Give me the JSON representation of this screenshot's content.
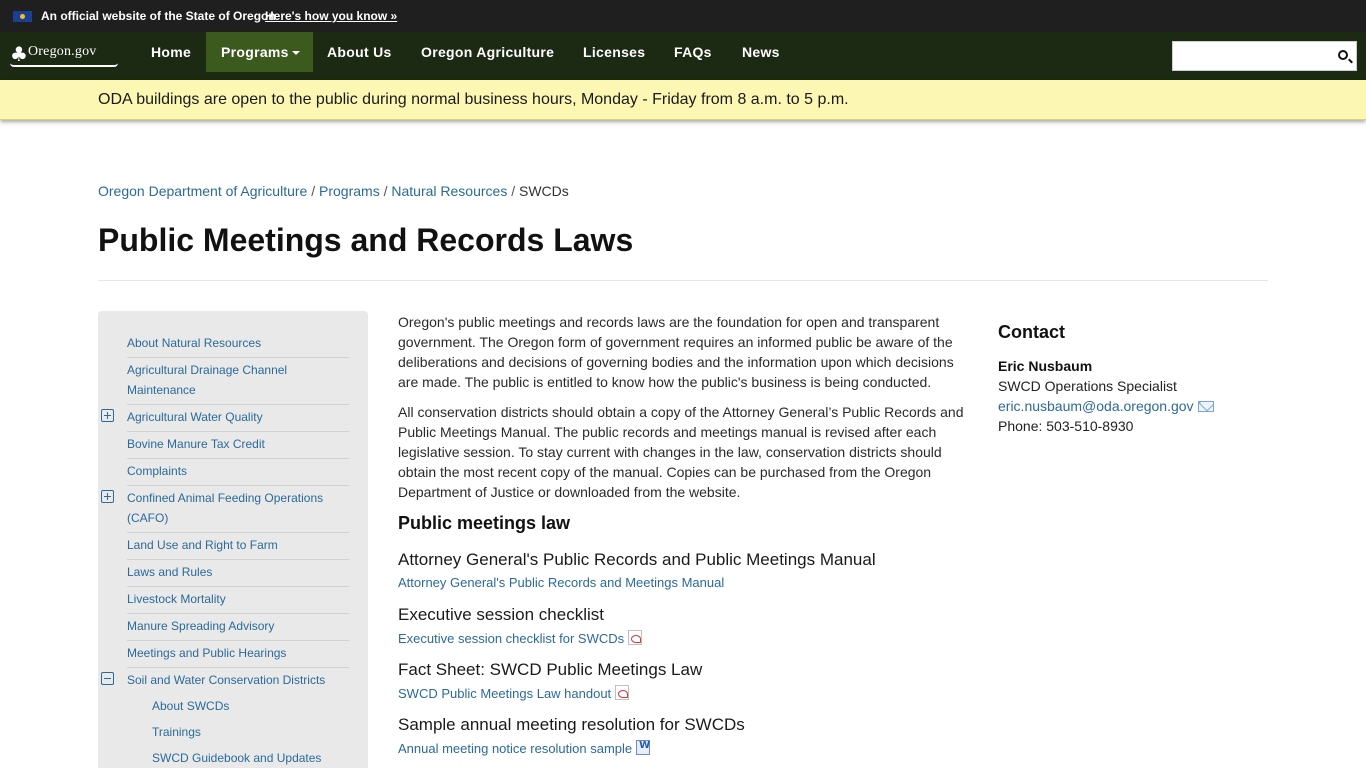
{
  "gov_banner": {
    "text": "An official website of the State of Oregon",
    "link": "Here's how you know »"
  },
  "navbar": {
    "logo_text": "Oregon.gov",
    "items": [
      {
        "label": "Home"
      },
      {
        "label": "Programs"
      },
      {
        "label": "About Us"
      },
      {
        "label": "Oregon Agriculture"
      },
      {
        "label": "Licenses"
      },
      {
        "label": "FAQs"
      },
      {
        "label": "News"
      }
    ],
    "search_placeholder": ""
  },
  "alert": {
    "text": "ODA buildings are open to the public during normal business hours, Monday - Friday from 8 a.m. to 5 p.m."
  },
  "breadcrumb": {
    "items": [
      "Oregon Department of Agriculture",
      "Programs",
      "Natural Resources"
    ],
    "current": "SWCDs",
    "separator": "/"
  },
  "page": {
    "title": "Public Meetings and Records Laws"
  },
  "sidebar": {
    "items": [
      {
        "label": "About Natural Resources"
      },
      {
        "label": "Agricultural Drainage Channel Maintenance"
      },
      {
        "label": "Agricultural Water Quality"
      },
      {
        "label": "Bovine Manure Tax Credit"
      },
      {
        "label": "Complaints"
      },
      {
        "label": "Confined Animal Feeding Operations (CAFO)"
      },
      {
        "label": "Land Use and Right to Farm"
      },
      {
        "label": "Laws and Rules"
      },
      {
        "label": "Livestock Mortality"
      },
      {
        "label": "Manure Spreading Advisory"
      },
      {
        "label": "Meetings and Public Hearings"
      },
      {
        "label": "Soil and Water Conservation Districts"
      }
    ],
    "subitems": [
      {
        "label": "About SWCDs"
      },
      {
        "label": "Trainings"
      },
      {
        "label": "SWCD Guidebook and Updates"
      }
    ]
  },
  "main": {
    "paragraphs": [
      "Oregon's public meetings and records laws are the foundation for open and transparent government. The Oregon form of government requires an informed public be aware of the deliberations and decisions of governing bodies and the information upon which decisions are made. The public is entitled to know how the public's business is being conducted.",
      "All conservation districts should obtain a copy of the Attorney General’s Public Records and Public Meetings Manual. The public records and meetings manual is revised after each legislative session. To stay current with changes in the law, conservation districts should obtain the most recent copy of the manual. Copies can be purchased from the Oregon Department of Justice or downloaded from the website."
    ],
    "section_heading": "Public meetings law",
    "documents": [
      {
        "title": "Attorney General's Public Records and Public Meetings Manual",
        "link": "Attorney General's Public Records and Meetings Manual",
        "icon": "none"
      },
      {
        "title": "Executive session checklist",
        "link": "Executive session checklist for SWCDs",
        "icon": "pdf-icon"
      },
      {
        "title": "Fact Sheet: SWCD Public Meetings Law",
        "link": "SWCD Public Meetings Law handout",
        "icon": "pdf-icon"
      },
      {
        "title": "Sample annual meeting resolution for SWCDs",
        "link": "Annual meeting notice resolution sample",
        "icon": "word-doc-icon"
      }
    ]
  },
  "contact": {
    "heading": "Contact",
    "name": "Eric Nusbaum",
    "role": "SWCD Operations Specialist",
    "email": "eric.nusbaum@oda.oregon.gov",
    "phone": "Phone: 503-510-8930"
  },
  "colors": {
    "navbar": "#1c2a14",
    "nav_active": "#3c5a1e",
    "alert_bg": "#fdf7b4",
    "link": "#2b6a99"
  }
}
